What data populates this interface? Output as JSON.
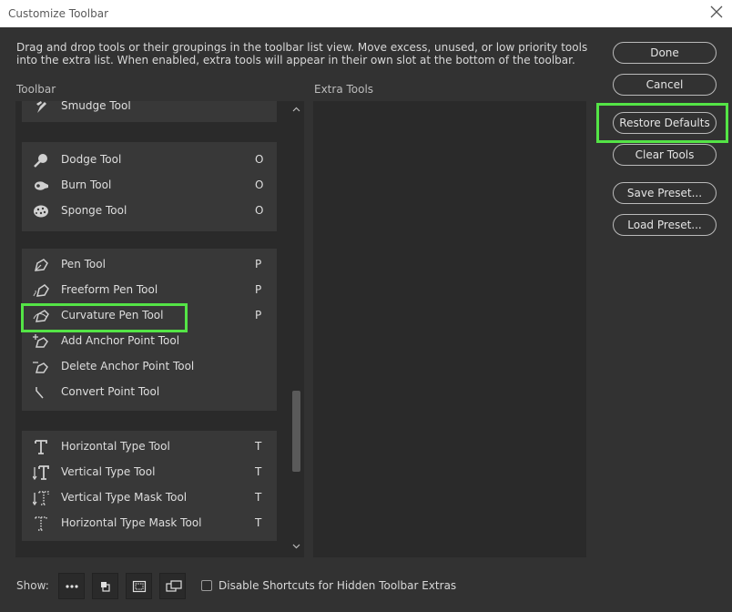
{
  "window": {
    "title": "Customize Toolbar"
  },
  "description": "Drag and drop tools or their groupings in the toolbar list view. Move excess, unused, or low priority tools into the extra list. When enabled, extra tools will appear in their own slot at the bottom of the toolbar.",
  "toolbar_label": "Toolbar",
  "extra_label": "Extra Tools",
  "groups": [
    {
      "tools": [
        {
          "name": "Smudge Tool",
          "key": "",
          "icon": "smudge-icon"
        }
      ]
    },
    {
      "tools": [
        {
          "name": "Dodge Tool",
          "key": "O",
          "icon": "dodge-icon"
        },
        {
          "name": "Burn Tool",
          "key": "O",
          "icon": "burn-icon"
        },
        {
          "name": "Sponge Tool",
          "key": "O",
          "icon": "sponge-icon"
        }
      ]
    },
    {
      "tools": [
        {
          "name": "Pen Tool",
          "key": "P",
          "icon": "pen-icon"
        },
        {
          "name": "Freeform Pen Tool",
          "key": "P",
          "icon": "freeform-pen-icon"
        },
        {
          "name": "Curvature Pen Tool",
          "key": "P",
          "icon": "curvature-pen-icon"
        },
        {
          "name": "Add Anchor Point Tool",
          "key": "",
          "icon": "add-anchor-point-icon"
        },
        {
          "name": "Delete Anchor Point Tool",
          "key": "",
          "icon": "delete-anchor-point-icon"
        },
        {
          "name": "Convert Point Tool",
          "key": "",
          "icon": "convert-point-icon"
        }
      ]
    },
    {
      "tools": [
        {
          "name": "Horizontal Type Tool",
          "key": "T",
          "icon": "horizontal-type-icon"
        },
        {
          "name": "Vertical Type Tool",
          "key": "T",
          "icon": "vertical-type-icon"
        },
        {
          "name": "Vertical Type Mask Tool",
          "key": "T",
          "icon": "vertical-type-mask-icon"
        },
        {
          "name": "Horizontal Type Mask Tool",
          "key": "T",
          "icon": "horizontal-type-mask-icon"
        }
      ]
    }
  ],
  "buttons": {
    "done": "Done",
    "cancel": "Cancel",
    "restore": "Restore Defaults",
    "clear": "Clear Tools",
    "save": "Save Preset...",
    "load": "Load Preset..."
  },
  "show_label": "Show:",
  "show_icons": [
    "more-icon",
    "swatch-icon",
    "screen-mode-icon",
    "artboard-icon"
  ],
  "checkbox_label": "Disable Shortcuts for Hidden Toolbar Extras",
  "checkbox_checked": false,
  "highlight_color": "#54e446"
}
